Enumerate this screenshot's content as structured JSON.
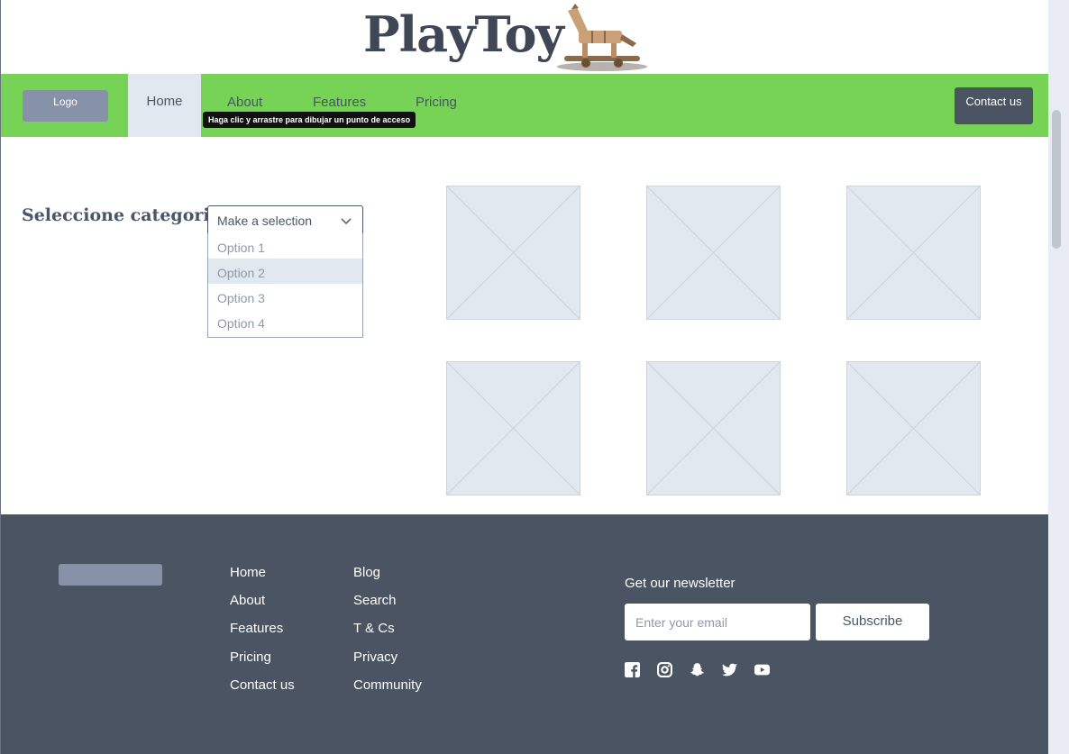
{
  "brand": {
    "title": "PlayToy",
    "logo_icon": "rocking-horse-icon"
  },
  "nav": {
    "logo_label": "Logo",
    "items": [
      "Home",
      "About",
      "Features",
      "Pricing"
    ],
    "tooltip": "Haga clic y arrastre para dibujar un punto de acceso",
    "contact_label": "Contact us",
    "colors": {
      "bar": "#76d356",
      "active": "#e2e8f0",
      "button": "#4a5462"
    }
  },
  "category": {
    "label": "Seleccione categoria",
    "select_value": "Make a selection",
    "options": [
      "Option 1",
      "Option 2",
      "Option 3",
      "Option 4"
    ],
    "highlighted_option": "Option 2"
  },
  "products": {
    "placeholder_icon": "image-placeholder-icon",
    "count": 6
  },
  "footer": {
    "col1": [
      "Home",
      "About",
      "Features",
      "Pricing",
      "Contact us"
    ],
    "col2": [
      "Blog",
      "Search",
      "T & Cs",
      "Privacy",
      "Community"
    ],
    "newsletter_label": "Get our newsletter",
    "email_placeholder": "Enter your email",
    "subscribe_label": "Subscribe",
    "social_icons": [
      "facebook-icon",
      "instagram-icon",
      "snapchat-icon",
      "twitter-icon",
      "youtube-icon"
    ],
    "background": "#4a5462"
  }
}
